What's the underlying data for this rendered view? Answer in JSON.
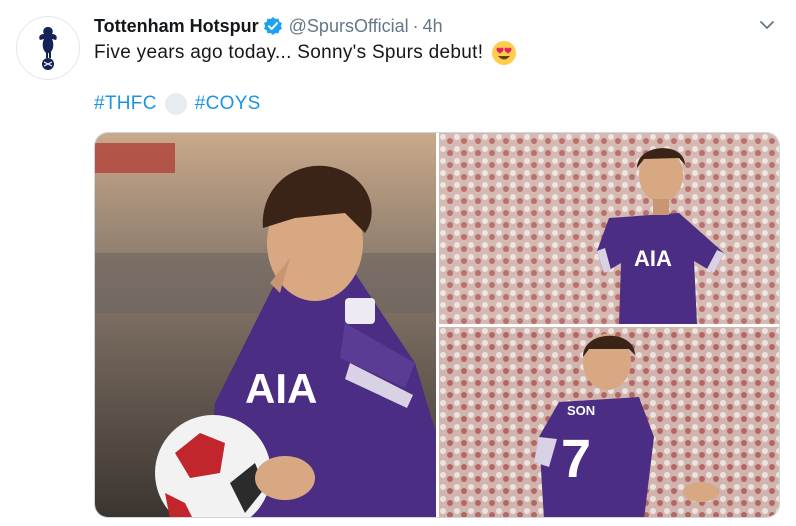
{
  "account": {
    "name": "Tottenham Hotspur",
    "handle": "@SpursOfficial",
    "separator": "·",
    "time": "4h",
    "verified": true,
    "avatar_icon": "spurs-cockerel-icon"
  },
  "tweet": {
    "text": "Five years ago today... Sonny's Spurs debut!",
    "emoji": "heart-eyes-emoji",
    "hashtags": [
      "#THFC",
      "#COYS"
    ]
  },
  "media": {
    "photos": [
      {
        "jersey_text": "AIA",
        "icon": "photo-son-with-ball"
      },
      {
        "jersey_text": "AIA",
        "icon": "photo-son-front"
      },
      {
        "jersey_name": "SON",
        "jersey_number": "7",
        "icon": "photo-son-back"
      }
    ]
  },
  "colors": {
    "link": "#1b95e0",
    "secondary_text": "#657786",
    "verified": "#1da1f2",
    "kit_purple": "#4b2e83"
  }
}
